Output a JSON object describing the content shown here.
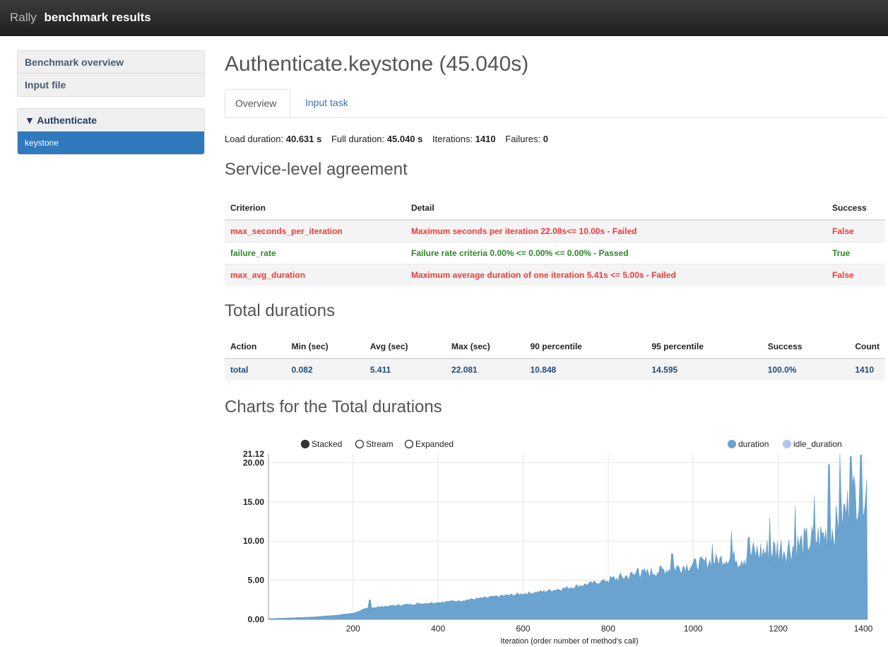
{
  "header": {
    "app": "Rally",
    "title": "benchmark results"
  },
  "sidebar": {
    "group1": [
      "Benchmark overview",
      "Input file"
    ],
    "section": "▼ Authenticate",
    "active": "keystone"
  },
  "main": {
    "title": "Authenticate.keystone (45.040s)",
    "tabs": [
      {
        "label": "Overview",
        "active": true
      },
      {
        "label": "Input task",
        "active": false
      }
    ],
    "summary": {
      "load_label": "Load duration:",
      "load_value": "40.631 s",
      "full_label": "Full duration:",
      "full_value": "45.040 s",
      "iter_label": "Iterations:",
      "iter_value": "1410",
      "fail_label": "Failures:",
      "fail_value": "0"
    },
    "sla_heading": "Service-level agreement",
    "sla_table": {
      "headers": [
        "Criterion",
        "Detail",
        "Success"
      ],
      "rows": [
        [
          "max_seconds_per_iteration",
          "Maximum seconds per iteration 22.08s<= 10.00s - Failed",
          "False"
        ],
        [
          "failure_rate",
          "Failure rate criteria 0.00% <= 0.00% <= 0.00% - Passed",
          "True"
        ],
        [
          "max_avg_duration",
          "Maximum average duration of one iteration 5.41s <= 5.00s - Failed",
          "False"
        ]
      ]
    },
    "durations_heading": "Total durations",
    "durations_table": {
      "headers": [
        "Action",
        "Min (sec)",
        "Avg (sec)",
        "Max (sec)",
        "90 percentile",
        "95 percentile",
        "Success",
        "Count"
      ],
      "row": [
        "total",
        "0.082",
        "5.411",
        "22.081",
        "10.848",
        "14.595",
        "100.0%",
        "1410"
      ]
    },
    "charts_heading": "Charts for the Total durations"
  },
  "colors": {
    "duration": "#6aa3cf",
    "idle_duration": "#aec7e8",
    "fail": "#f23a3a",
    "pass": "#2a8a25",
    "active": "#2f79bd"
  },
  "chart_data": {
    "type": "area",
    "controls": [
      "Stacked",
      "Stream",
      "Expanded"
    ],
    "selected_control": "Stacked",
    "legend": [
      "duration",
      "idle_duration"
    ],
    "xlabel": "Iteration (order number of method's call)",
    "ylabel": "",
    "x_ticks": [
      200,
      400,
      600,
      800,
      1000,
      1200,
      1400
    ],
    "y_ticks": [
      "0.00",
      "5.00",
      "10.00",
      "15.00",
      "20.00",
      "21.12"
    ],
    "xlim": [
      1,
      1410
    ],
    "ylim": [
      0,
      21.12
    ],
    "series": [
      {
        "name": "duration",
        "x": [
          1,
          50,
          100,
          150,
          200,
          220,
          240,
          260,
          280,
          300,
          350,
          400,
          450,
          500,
          550,
          600,
          650,
          700,
          750,
          800,
          850,
          900,
          950,
          1000,
          1050,
          1100,
          1150,
          1200,
          1250,
          1300,
          1330,
          1360,
          1380,
          1400,
          1410
        ],
        "y": [
          0.1,
          0.2,
          0.3,
          0.5,
          0.8,
          1.2,
          1.5,
          1.6,
          1.7,
          1.8,
          2.0,
          2.2,
          2.4,
          2.7,
          3.0,
          3.3,
          3.6,
          4.0,
          4.5,
          5.0,
          5.6,
          6.0,
          6.5,
          7.0,
          7.5,
          8.0,
          8.5,
          9.0,
          9.5,
          10.5,
          11.5,
          14.0,
          16.0,
          17.0,
          17.5
        ]
      },
      {
        "name": "idle_duration",
        "x": [
          1,
          1410
        ],
        "y": [
          0,
          0
        ]
      }
    ],
    "peaks": [
      {
        "x": 240,
        "y": 2.5
      },
      {
        "x": 870,
        "y": 6.5
      },
      {
        "x": 950,
        "y": 8.4
      },
      {
        "x": 1045,
        "y": 9.6
      },
      {
        "x": 1090,
        "y": 11.3
      },
      {
        "x": 1130,
        "y": 10.5
      },
      {
        "x": 1180,
        "y": 13.0
      },
      {
        "x": 1240,
        "y": 14.5
      },
      {
        "x": 1285,
        "y": 15.8
      },
      {
        "x": 1320,
        "y": 19.8
      },
      {
        "x": 1345,
        "y": 21.12
      },
      {
        "x": 1370,
        "y": 20.8
      },
      {
        "x": 1395,
        "y": 21.0
      }
    ]
  }
}
